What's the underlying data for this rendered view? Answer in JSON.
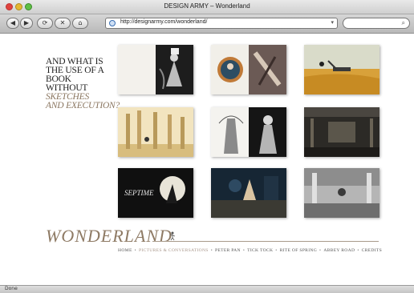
{
  "window": {
    "title": "DESIGN ARMY – Wonderland"
  },
  "toolbar": {
    "back_label": "◀",
    "forward_label": "▶",
    "reload_label": "⟳",
    "stop_label": "✕",
    "home_label": "⌂",
    "url": "http://designarmy.com/wonderland/",
    "dropdown_label": "▾",
    "search_label": "⌕"
  },
  "content": {
    "tagline_plain": [
      "AND WHAT IS",
      "THE USE OF A BOOK",
      "WITHOUT"
    ],
    "tagline_emphasis": [
      "SKETCHES",
      "AND EXECUTION?"
    ],
    "logo": "WONDERLAND"
  },
  "nav": {
    "items": [
      "HOME",
      "PICTURES & CONVERSATIONS",
      "PETER PAN",
      "TICK TOCK",
      "RITE OF SPRING",
      "ABBEY ROAD",
      "CREDITS"
    ],
    "active_index": 1,
    "separator": "•"
  },
  "status": {
    "text": "Done"
  },
  "colors": {
    "accent": "#8e7a64",
    "nav_active": "#a8968a"
  },
  "thumbnails": [
    {
      "name": "book-sketches",
      "row": 1,
      "col": 1
    },
    {
      "name": "circle-portrait",
      "row": 1,
      "col": 2
    },
    {
      "name": "golden-field",
      "row": 1,
      "col": 3
    },
    {
      "name": "golden-columns",
      "row": 2,
      "col": 1
    },
    {
      "name": "tower-sketch",
      "row": 2,
      "col": 2
    },
    {
      "name": "dark-hall",
      "row": 2,
      "col": 3
    },
    {
      "name": "september-moon",
      "row": 3,
      "col": 1
    },
    {
      "name": "blue-bar-scene",
      "row": 3,
      "col": 2
    },
    {
      "name": "ballroom-gray",
      "row": 3,
      "col": 3
    }
  ],
  "thumb_text": {
    "sept_label": "SEPTIME"
  }
}
